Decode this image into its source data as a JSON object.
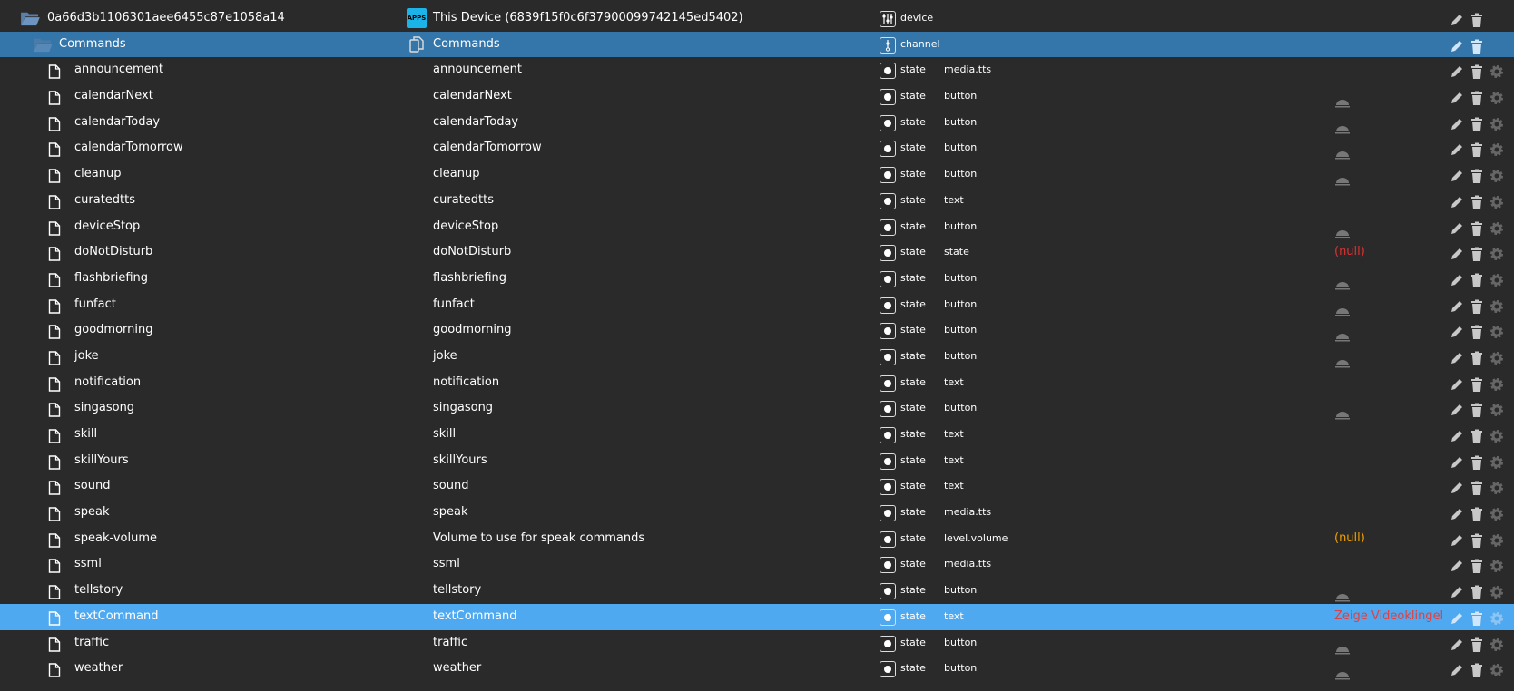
{
  "rows": [
    {
      "name": "0a66d3b1106301aee6455c87e1058a14",
      "desc": "This Device (6839f15f0c6f37900099742145ed5402)",
      "kind": "device",
      "type": "device",
      "role": "",
      "value": "",
      "folder": true,
      "indent": 0,
      "desc_icon": "apps-icon",
      "app_badge": "APPS"
    },
    {
      "name": "Commands",
      "desc": "Commands",
      "kind": "channel",
      "type": "channel",
      "role": "",
      "value": "",
      "folder": true,
      "indent": 1,
      "desc_icon": "copy-icon",
      "selected": true
    },
    {
      "name": "announcement",
      "desc": "announcement",
      "type": "state",
      "role": "media.tts",
      "value": ""
    },
    {
      "name": "calendarNext",
      "desc": "calendarNext",
      "type": "state",
      "role": "button",
      "value": "",
      "bell": true
    },
    {
      "name": "calendarToday",
      "desc": "calendarToday",
      "type": "state",
      "role": "button",
      "value": "",
      "bell": true
    },
    {
      "name": "calendarTomorrow",
      "desc": "calendarTomorrow",
      "type": "state",
      "role": "button",
      "value": "",
      "bell": true
    },
    {
      "name": "cleanup",
      "desc": "cleanup",
      "type": "state",
      "role": "button",
      "value": "",
      "bell": true
    },
    {
      "name": "curatedtts",
      "desc": "curatedtts",
      "type": "state",
      "role": "text",
      "value": ""
    },
    {
      "name": "deviceStop",
      "desc": "deviceStop",
      "type": "state",
      "role": "button",
      "value": "",
      "bell": true
    },
    {
      "name": "doNotDisturb",
      "desc": "doNotDisturb",
      "type": "state",
      "role": "state",
      "value": "(null)",
      "value_color": "#e03030"
    },
    {
      "name": "flashbriefing",
      "desc": "flashbriefing",
      "type": "state",
      "role": "button",
      "value": "",
      "bell": true
    },
    {
      "name": "funfact",
      "desc": "funfact",
      "type": "state",
      "role": "button",
      "value": "",
      "bell": true
    },
    {
      "name": "goodmorning",
      "desc": "goodmorning",
      "type": "state",
      "role": "button",
      "value": "",
      "bell": true
    },
    {
      "name": "joke",
      "desc": "joke",
      "type": "state",
      "role": "button",
      "value": "",
      "bell": true
    },
    {
      "name": "notification",
      "desc": "notification",
      "type": "state",
      "role": "text",
      "value": ""
    },
    {
      "name": "singasong",
      "desc": "singasong",
      "type": "state",
      "role": "button",
      "value": "",
      "bell": true
    },
    {
      "name": "skill",
      "desc": "skill",
      "type": "state",
      "role": "text",
      "value": ""
    },
    {
      "name": "skillYours",
      "desc": "skillYours",
      "type": "state",
      "role": "text",
      "value": ""
    },
    {
      "name": "sound",
      "desc": "sound",
      "type": "state",
      "role": "text",
      "value": ""
    },
    {
      "name": "speak",
      "desc": "speak",
      "type": "state",
      "role": "media.tts",
      "value": ""
    },
    {
      "name": "speak-volume",
      "desc": "Volume to use for speak commands",
      "type": "state",
      "role": "level.volume",
      "value": "(null)",
      "value_color": "#f0a000"
    },
    {
      "name": "ssml",
      "desc": "ssml",
      "type": "state",
      "role": "media.tts",
      "value": ""
    },
    {
      "name": "tellstory",
      "desc": "tellstory",
      "type": "state",
      "role": "button",
      "value": "",
      "bell": true
    },
    {
      "name": "textCommand",
      "desc": "textCommand",
      "type": "state",
      "role": "text",
      "value": "Zeige Videoklingel",
      "value_color": "#e04040",
      "highlighted": true
    },
    {
      "name": "traffic",
      "desc": "traffic",
      "type": "state",
      "role": "button",
      "value": "",
      "bell": true
    },
    {
      "name": "weather",
      "desc": "weather",
      "type": "state",
      "role": "button",
      "value": "",
      "bell": true
    }
  ]
}
